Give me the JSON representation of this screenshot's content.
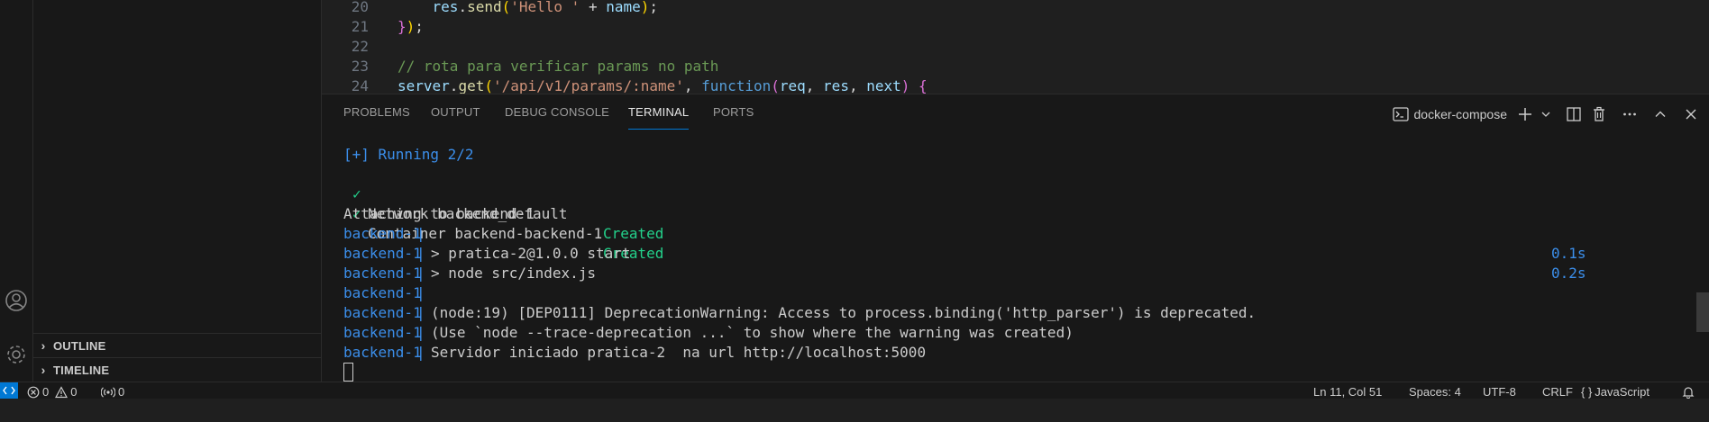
{
  "editor": {
    "lines": [
      {
        "num": "20",
        "indent": "    ",
        "tokens": [
          {
            "t": "res",
            "c": "var"
          },
          {
            "t": ".",
            "c": "op"
          },
          {
            "t": "send",
            "c": "func"
          },
          {
            "t": "(",
            "c": "punc2"
          },
          {
            "t": "'Hello '",
            "c": "str"
          },
          {
            "t": " + ",
            "c": "op"
          },
          {
            "t": "name",
            "c": "var"
          },
          {
            "t": ")",
            "c": "punc2"
          },
          {
            "t": ";",
            "c": "op"
          }
        ]
      },
      {
        "num": "21",
        "indent": "",
        "tokens": [
          {
            "t": "}",
            "c": "punc"
          },
          {
            "t": ")",
            "c": "punc2"
          },
          {
            "t": ";",
            "c": "op"
          }
        ]
      },
      {
        "num": "22",
        "indent": "",
        "tokens": []
      },
      {
        "num": "23",
        "indent": "",
        "tokens": [
          {
            "t": "// rota para verificar params no path",
            "c": "comment"
          }
        ]
      },
      {
        "num": "24",
        "indent": "",
        "tokens": [
          {
            "t": "server",
            "c": "var"
          },
          {
            "t": ".",
            "c": "op"
          },
          {
            "t": "get",
            "c": "func"
          },
          {
            "t": "(",
            "c": "punc2"
          },
          {
            "t": "'/api/v1/params/:name'",
            "c": "str"
          },
          {
            "t": ", ",
            "c": "op"
          },
          {
            "t": "function",
            "c": "kw"
          },
          {
            "t": "(",
            "c": "punc"
          },
          {
            "t": "req",
            "c": "var"
          },
          {
            "t": ", ",
            "c": "op"
          },
          {
            "t": "res",
            "c": "var"
          },
          {
            "t": ", ",
            "c": "op"
          },
          {
            "t": "next",
            "c": "var"
          },
          {
            "t": ")",
            "c": "punc"
          },
          {
            "t": " {",
            "c": "punc"
          }
        ]
      }
    ]
  },
  "sidebar": {
    "sections": [
      {
        "label": "OUTLINE"
      },
      {
        "label": "TIMELINE"
      }
    ]
  },
  "panel": {
    "tabs": [
      {
        "label": "PROBLEMS"
      },
      {
        "label": "OUTPUT"
      },
      {
        "label": "DEBUG CONSOLE"
      },
      {
        "label": "TERMINAL",
        "active": true
      },
      {
        "label": "PORTS"
      }
    ],
    "terminal_name": "docker-compose"
  },
  "terminal": {
    "running": "[+] Running 2/2",
    "items": [
      {
        "check": "✓",
        "name": "Network backend_default",
        "status": "Created",
        "time": "0.1s"
      },
      {
        "check": "✓",
        "name": "Container backend-backend-1",
        "status": "Created",
        "time": "0.2s"
      }
    ],
    "attaching": "Attaching to backend-1",
    "log_prefix": "backend-1",
    "log_sep": "|",
    "logs": [
      "",
      "> pratica-2@1.0.0 start",
      "> node src/index.js",
      "",
      "(node:19) [DEP0111] DeprecationWarning: Access to process.binding('http_parser') is deprecated.",
      "(Use `node --trace-deprecation ...` to show where the warning was created)",
      "Servidor iniciado pratica-2  na url http://localhost:5000"
    ]
  },
  "statusbar": {
    "errors": "0",
    "warnings": "0",
    "ports": "0",
    "position": "Ln 11, Col 51",
    "spaces": "Spaces: 4",
    "encoding": "UTF-8",
    "eol": "CRLF",
    "language_icon": "{ }",
    "language": "JavaScript"
  },
  "colors": {
    "accent": "#0078d4",
    "terminal_blue": "#3b8eea",
    "terminal_green": "#23d18b",
    "background": "#181818"
  }
}
